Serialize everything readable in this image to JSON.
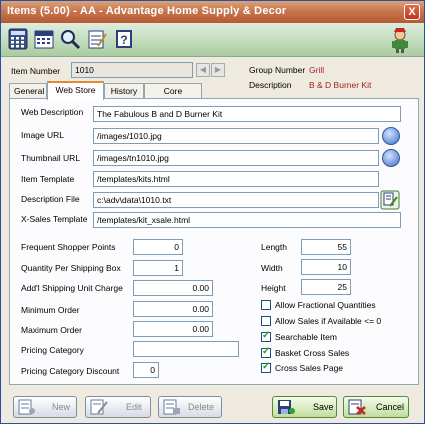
{
  "window": {
    "title": "Items (5.00) - AA - Advantage Home Supply & Decor",
    "close": "X"
  },
  "toolbar": {
    "icons": [
      "calculator-icon",
      "calendar-icon",
      "magnifier-icon",
      "notepad-icon",
      "help-icon",
      "mascot-icon"
    ]
  },
  "header": {
    "item_number_label": "Item Number",
    "item_number_value": "1010",
    "group_number_label": "Group Number",
    "group_number_value": "Grill",
    "description_label": "Description",
    "description_value": "B & D Burner Kit"
  },
  "tabs": [
    {
      "label": "General"
    },
    {
      "label": "Web Store"
    },
    {
      "label": "History"
    },
    {
      "label": "Core Charge"
    }
  ],
  "webstore": {
    "web_description_label": "Web Description",
    "web_description_value": "The Fabulous B and D Burner Kit",
    "image_url_label": "Image URL",
    "image_url_value": "/images/1010.jpg",
    "thumbnail_url_label": "Thumbnail URL",
    "thumbnail_url_value": "/images/tn1010.jpg",
    "item_template_label": "Item Template",
    "item_template_value": "/templates/kits.html",
    "description_file_label": "Description File",
    "description_file_value": "c:\\adv\\data\\1010.txt",
    "xsales_template_label": "X-Sales Template",
    "xsales_template_value": "/templates/kit_xsale.html"
  },
  "numbers": {
    "frequent_shopper_label": "Frequent Shopper Points",
    "frequent_shopper_value": "0",
    "qty_per_box_label": "Quantity Per Shipping Box",
    "qty_per_box_value": "1",
    "addl_shipping_label": "Add'l Shipping Unit Charge",
    "addl_shipping_value": "0.00",
    "minimum_order_label": "Minimum Order",
    "minimum_order_value": "0.00",
    "maximum_order_label": "Maximum Order",
    "maximum_order_value": "0.00",
    "pricing_category_label": "Pricing Category",
    "pricing_category_value": "",
    "pricing_discount_label": "Pricing Category Discount",
    "pricing_discount_value": "0"
  },
  "dimensions": {
    "length_label": "Length",
    "length_value": "55",
    "width_label": "Width",
    "width_value": "10",
    "height_label": "Height",
    "height_value": "25"
  },
  "checkboxes": [
    {
      "label": "Allow Fractional Quantities",
      "checked": false
    },
    {
      "label": "Allow Sales if Available <= 0",
      "checked": false
    },
    {
      "label": "Searchable Item",
      "checked": true
    },
    {
      "label": "Basket Cross Sales",
      "checked": true
    },
    {
      "label": "Cross Sales Page",
      "checked": true
    }
  ],
  "buttons": {
    "new": "New",
    "edit": "Edit",
    "delete": "Delete",
    "save": "Save",
    "cancel": "Cancel"
  }
}
